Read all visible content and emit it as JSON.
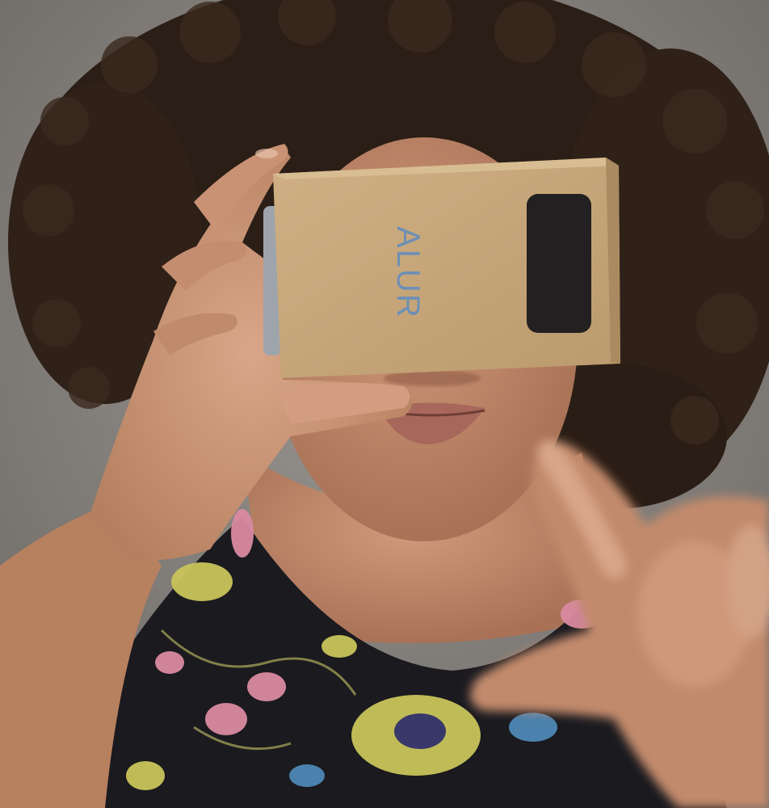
{
  "photo": {
    "subject": "",
    "viewer": {
      "brand_text": "ALUR"
    },
    "colors": {
      "background_fabric": "#8d8984",
      "hair": "#2b1e16",
      "skin": "#c08a6c",
      "skin_shadow": "#a26f55",
      "cardboard": "#c7a77b",
      "cardboard_edge": "#a98a61",
      "lens_window": "#222020",
      "brand_text": "#6d8fb5",
      "dress": "#1a1a1f",
      "floral_yellow": "#c8c45a",
      "floral_pink": "#d98aa0",
      "floral_blue": "#4d88b5"
    }
  }
}
